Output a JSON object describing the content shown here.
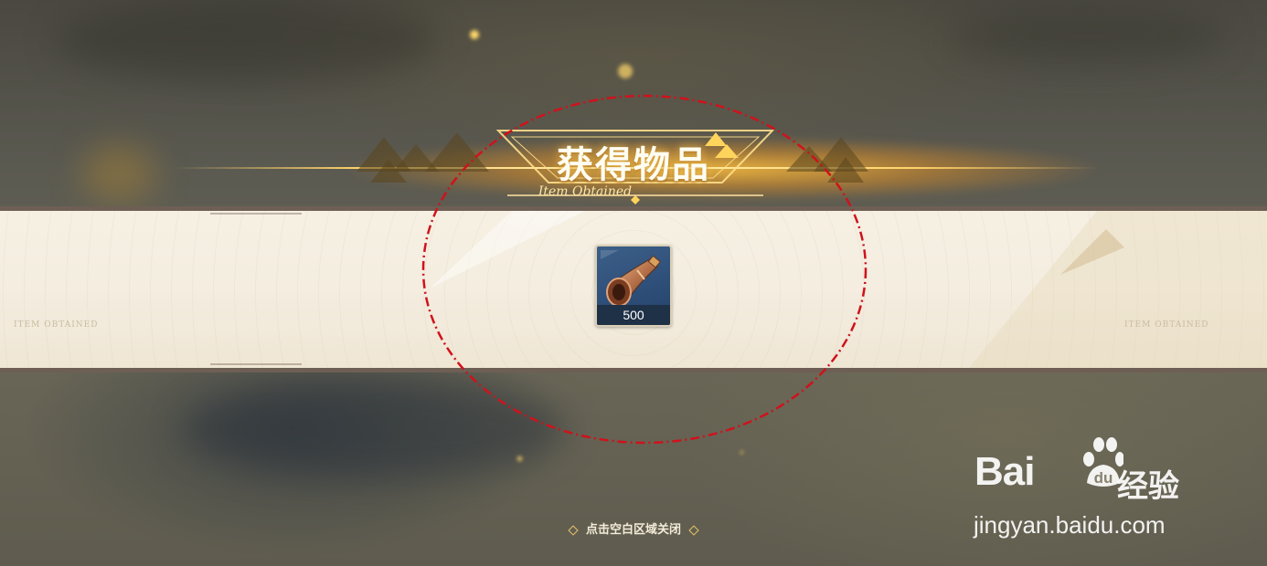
{
  "dialog": {
    "title": "获得物品",
    "subtitle": "Item Obtained",
    "close_hint": "点击空白区域关闭"
  },
  "band": {
    "faint_text_left": "ITEM OBTAINED",
    "faint_text_right": "ITEM OBTAINED"
  },
  "items": [
    {
      "name": "horn-item-icon",
      "count": "500"
    }
  ],
  "watermark": {
    "brand_latin": "Bai",
    "brand_du": "du",
    "brand_cn": "经验",
    "url": "jingyan.baidu.com"
  },
  "colors": {
    "band": "#f4ede0",
    "band_border": "#6e5f55",
    "title_glow": "#ffbe3c",
    "item_bg": "#2e4f79",
    "annotation": "#d0121b"
  }
}
